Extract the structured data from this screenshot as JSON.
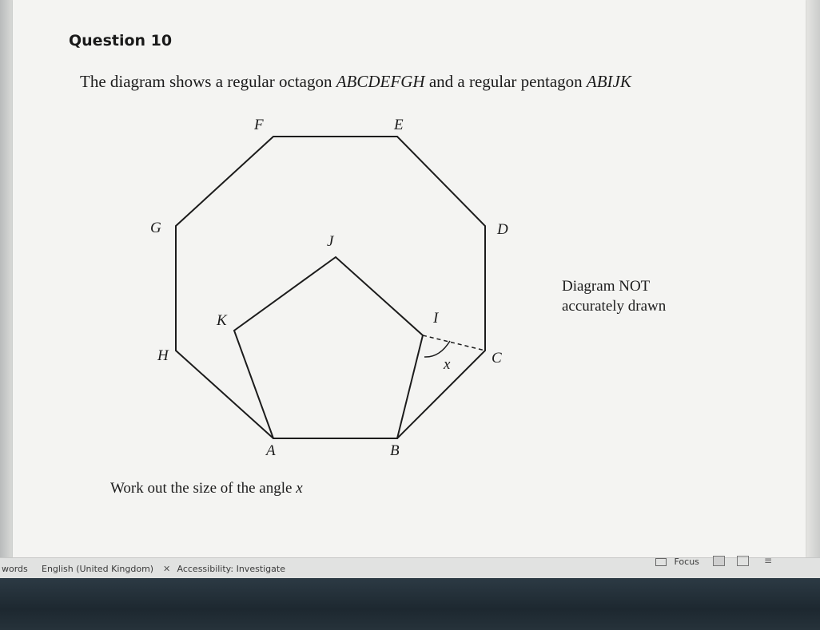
{
  "question": {
    "title": "Question 10",
    "intro_plain": "The diagram shows a regular octagon ",
    "octagon_name": "ABCDEFGH",
    "intro_mid": " and a regular pentagon ",
    "pentagon_name": "ABIJK",
    "note_line1": "Diagram NOT",
    "note_line2": "accurately drawn",
    "task_plain": "Work out the size of the angle ",
    "task_var": "x"
  },
  "diagram": {
    "labels": {
      "A": "A",
      "B": "B",
      "C": "C",
      "D": "D",
      "E": "E",
      "F": "F",
      "G": "G",
      "H": "H",
      "I": "I",
      "J": "J",
      "K": "K",
      "x": "x"
    }
  },
  "statusbar": {
    "words": "words",
    "language": "English (United Kingdom)",
    "accessibility": "Accessibility: Investigate",
    "focus": "Focus"
  },
  "icons": [
    "accessibility-icon",
    "focus-icon",
    "print-layout-icon",
    "web-layout-icon",
    "read-mode-icon"
  ],
  "colors": {
    "page": "#f4f4f2",
    "dock": "#1d2830",
    "text": "#1c1c1c"
  }
}
